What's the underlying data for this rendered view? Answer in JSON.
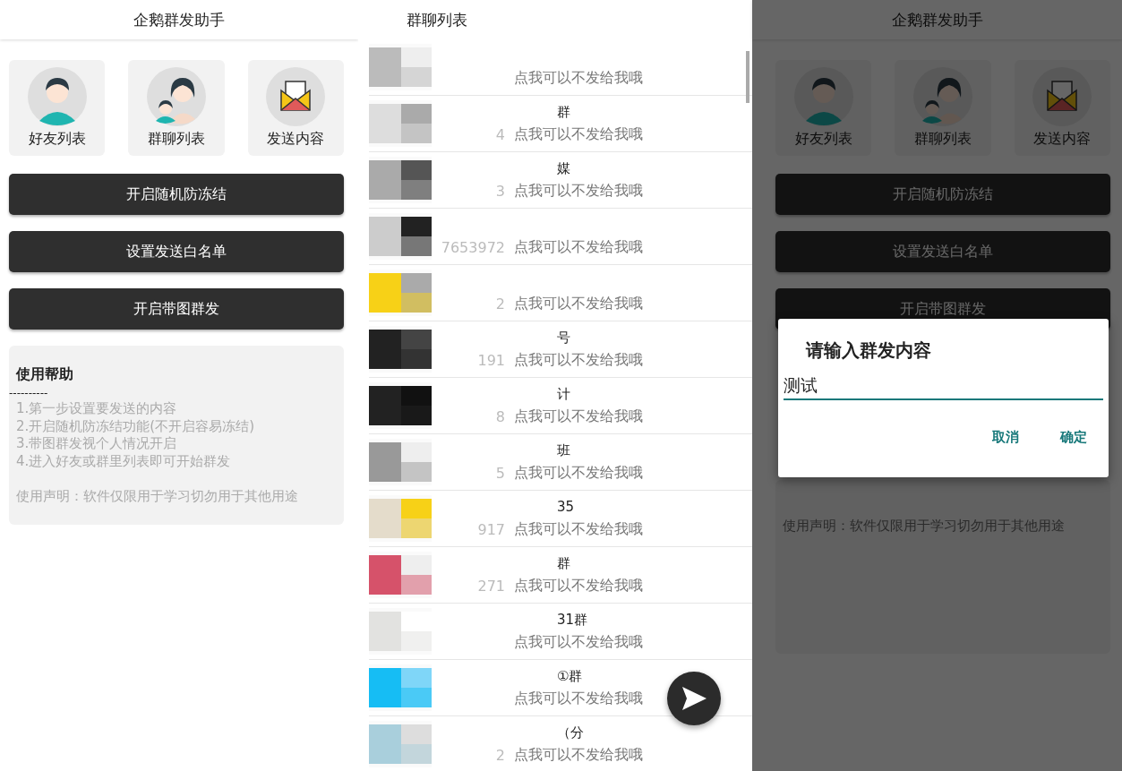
{
  "screens": [
    {
      "kind": "home",
      "title": "企鹅群发助手",
      "dimmed": false,
      "tiles": [
        {
          "kind": "person",
          "label": "好友列表"
        },
        {
          "kind": "people",
          "label": "群聊列表"
        },
        {
          "kind": "mail",
          "label": "发送内容"
        }
      ],
      "buttons": [
        "开启随机防冻结",
        "设置发送白名单",
        "开启带图群发"
      ],
      "help": {
        "heading": "使用帮助",
        "rule": "----------",
        "lines": [
          "1.第一步设置要发送的内容",
          "2.开启随机防冻结功能(不开启容易冻结)",
          "3.带图群发视个人情况开启",
          "4.进入好友或群里列表即可开始群发"
        ],
        "notice": "使用声明：软件仅限用于学习切勿用于其他用途"
      }
    },
    {
      "kind": "list",
      "title": "群聊列表",
      "rows": [
        {
          "name": "",
          "number": "",
          "subtitle": "点我可以不发给我哦"
        },
        {
          "name": "群",
          "number": "4",
          "subtitle": "点我可以不发给我哦"
        },
        {
          "name": "媒",
          "number": "3",
          "subtitle": "点我可以不发给我哦"
        },
        {
          "name": "",
          "number": "7653972",
          "subtitle": "点我可以不发给我哦"
        },
        {
          "name": "",
          "number": "2",
          "subtitle": "点我可以不发给我哦"
        },
        {
          "name": "号",
          "number": "191",
          "subtitle": "点我可以不发给我哦"
        },
        {
          "name": "计",
          "number": "8",
          "subtitle": "点我可以不发给我哦"
        },
        {
          "name": "班",
          "number": "5",
          "subtitle": "点我可以不发给我哦"
        },
        {
          "name": "35",
          "number": "917",
          "subtitle": "点我可以不发给我哦"
        },
        {
          "name": "群",
          "number": "271",
          "subtitle": "点我可以不发给我哦"
        },
        {
          "name": "31群",
          "number": "",
          "subtitle": "点我可以不发给我哦"
        },
        {
          "name": "①群",
          "number": "",
          "subtitle": "点我可以不发给我哦"
        },
        {
          "name": "（分",
          "number": "2",
          "subtitle": "点我可以不发给我哦"
        }
      ]
    },
    {
      "kind": "home",
      "title": "企鹅群发助手",
      "dimmed": true,
      "tiles": [
        {
          "kind": "person",
          "label": "好友列表"
        },
        {
          "kind": "people",
          "label": "群聊列表"
        },
        {
          "kind": "mail",
          "label": "发送内容"
        }
      ],
      "buttons": [
        "开启随机防冻结",
        "设置发送白名单",
        "开启带图群发"
      ],
      "help": {
        "notice": "使用声明：软件仅限用于学习切勿用于其他用途"
      },
      "dialog": {
        "title": "请输入群发内容",
        "value": "测试",
        "buttons": [
          "取消",
          "确定"
        ]
      }
    }
  ]
}
